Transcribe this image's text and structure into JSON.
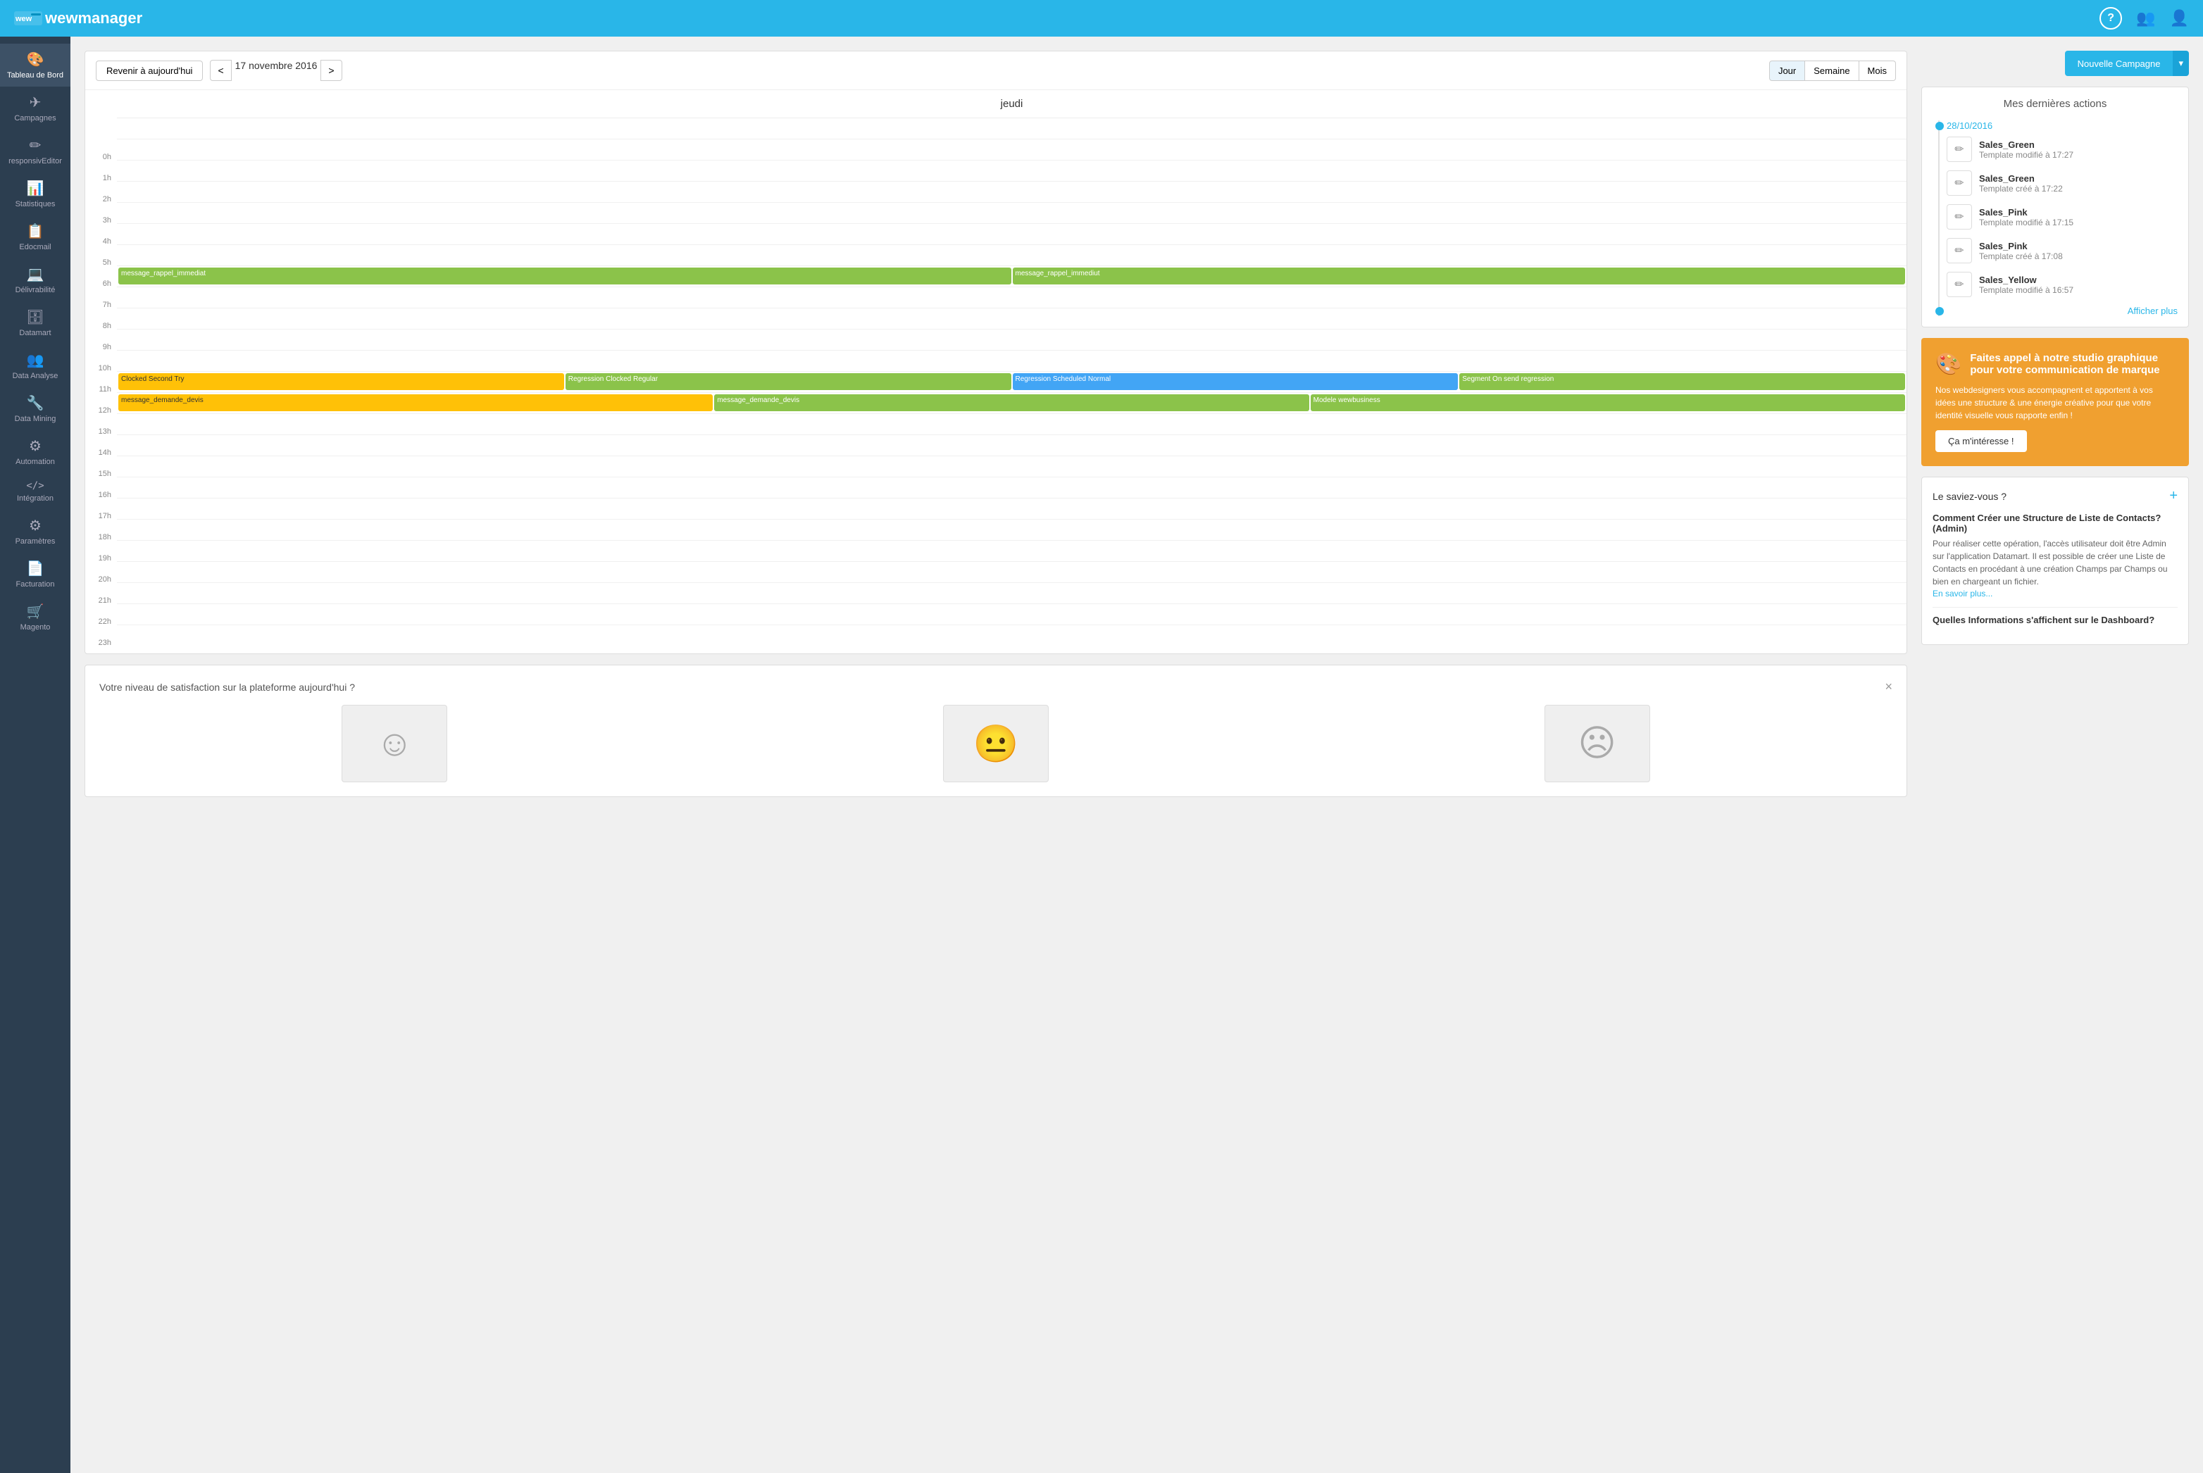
{
  "app": {
    "name": "wewmanager"
  },
  "topnav": {
    "help_icon": "?",
    "users_icon": "👥",
    "user_icon": "👤"
  },
  "sidebar": {
    "items": [
      {
        "id": "tableau-de-bord",
        "label": "Tableau de Bord",
        "icon": "🎨",
        "active": true
      },
      {
        "id": "campagnes",
        "label": "Campagnes",
        "icon": "✈"
      },
      {
        "id": "responsive-editor",
        "label": "responsivEditor",
        "icon": "✏"
      },
      {
        "id": "statistiques",
        "label": "Statistiques",
        "icon": "📊"
      },
      {
        "id": "edocmail",
        "label": "Edocmail",
        "icon": "📋"
      },
      {
        "id": "delivrabilite",
        "label": "Délivrabilité",
        "icon": "💻"
      },
      {
        "id": "datamart",
        "label": "Datamart",
        "icon": "🗄"
      },
      {
        "id": "data-analyse",
        "label": "Data Analyse",
        "icon": "👥"
      },
      {
        "id": "data-mining",
        "label": "Data Mining",
        "icon": "🔧"
      },
      {
        "id": "automation",
        "label": "Automation",
        "icon": "⚙"
      },
      {
        "id": "integration",
        "label": "Intégration",
        "icon": "</>"
      },
      {
        "id": "parametres",
        "label": "Paramètres",
        "icon": "🔧"
      },
      {
        "id": "facturation",
        "label": "Facturation",
        "icon": "📄"
      },
      {
        "id": "magento",
        "label": "Magento",
        "icon": "🛒"
      }
    ]
  },
  "calendar": {
    "today_btn": "Revenir à aujourd'hui",
    "current_date": "17 novembre 2016",
    "prev_icon": "<",
    "next_icon": ">",
    "view_day": "Jour",
    "view_week": "Semaine",
    "view_month": "Mois",
    "day_label": "jeudi",
    "hours": [
      "0h",
      "1h",
      "2h",
      "3h",
      "4h",
      "5h",
      "6h",
      "7h",
      "8h",
      "9h",
      "10h",
      "11h",
      "12h",
      "13h",
      "14h",
      "15h",
      "16h",
      "17h",
      "18h",
      "19h",
      "20h",
      "21h",
      "22h",
      "23h"
    ],
    "events": {
      "7h": [
        {
          "label": "message_rappel_immediat",
          "color": "green",
          "span": 0.4
        },
        {
          "label": "message_rappel_immediut",
          "color": "green",
          "span": 0.55
        }
      ],
      "12h": [
        {
          "label": "Clocked Second Try",
          "color": "yellow"
        },
        {
          "label": "Regression Clocked Regular",
          "color": "green"
        },
        {
          "label": "Regression Scheduled Normal",
          "color": "blue"
        },
        {
          "label": "Segment On send regression",
          "color": "green"
        }
      ],
      "13h": [
        {
          "label": "message_demande_devis",
          "color": "yellow"
        },
        {
          "label": "message_demande_devis",
          "color": "green"
        },
        {
          "label": "Modele wewbusiness",
          "color": "green"
        }
      ]
    }
  },
  "recent_actions": {
    "title": "Mes dernières actions",
    "date": "28/10/2016",
    "items": [
      {
        "name": "Sales_Green",
        "desc": "Template modifié à 17:27"
      },
      {
        "name": "Sales_Green",
        "desc": "Template créé à 17:22"
      },
      {
        "name": "Sales_Pink",
        "desc": "Template modifié à 17:15"
      },
      {
        "name": "Sales_Pink",
        "desc": "Template créé à 17:08"
      },
      {
        "name": "Sales_Yellow",
        "desc": "Template modifié à 16:57"
      }
    ],
    "show_more": "Afficher plus"
  },
  "new_campaign": {
    "label": "Nouvelle Campagne",
    "dropdown_icon": "▾"
  },
  "studio_promo": {
    "icon": "🎨",
    "title": "Faites appel à notre studio graphique pour votre communication de marque",
    "text": "Nos webdesigners vous accompagnent et apportent à vos idées une structure & une énergie créative pour que votre identité visuelle vous rapporte enfin !",
    "btn_label": "Ça m'intéresse !"
  },
  "did_you_know": {
    "title": "Le saviez-vous ?",
    "plus_icon": "+",
    "items": [
      {
        "question": "Comment Créer une Structure de Liste de Contacts? (Admin)",
        "answer": "Pour réaliser cette opération, l'accès utilisateur doit être Admin sur l'application Datamart. Il est possible de créer une Liste de Contacts en procédant à une création Champs par Champs ou bien en chargeant un fichier.",
        "link": "En savoir plus..."
      },
      {
        "question": "Quelles Informations s'affichent sur le Dashboard?",
        "answer": ""
      }
    ]
  },
  "satisfaction": {
    "title": "Votre niveau de satisfaction sur la plateforme aujourd'hui ?",
    "happy_icon": "☺",
    "neutral_icon": "😐",
    "sad_icon": "☹",
    "close_icon": "×"
  }
}
